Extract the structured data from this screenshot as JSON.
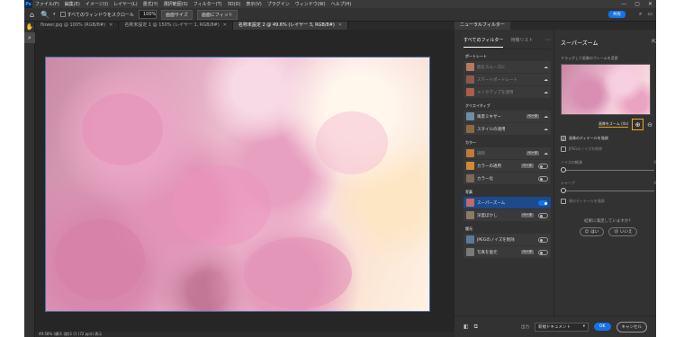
{
  "menubar": {
    "logo": "Ps",
    "items": [
      "ファイル(F)",
      "編集(E)",
      "イメージ(I)",
      "レイヤー(L)",
      "書式(Y)",
      "選択範囲(S)",
      "フィルター(T)",
      "3D(D)",
      "表示(V)",
      "プラグイン",
      "ウィンドウ(W)",
      "ヘルプ(H)"
    ],
    "win_min": "—",
    "win_max": "▢",
    "win_close": "✕"
  },
  "options": {
    "scroll_all_label": "すべてのウィンドウをスクロール",
    "zoom_value": "100%",
    "fit_screen": "画面サイズ",
    "fill_screen": "画面にフィット",
    "share": "共有"
  },
  "doc_tabs": [
    {
      "label": "flower.jpg @ 100% (RGB/8#)",
      "active": false
    },
    {
      "label": "名称未設定 1 @ 150% (レイヤー 1, RGB/8#)",
      "active": false
    },
    {
      "label": "名称未設定 2 @ 49.6% (レイヤー 3, RGB/8#)",
      "active": true
    }
  ],
  "status_bar": "49.58%  (横)1 (縦)1 (1 (72 ppi)) 表示",
  "neural_filters": {
    "tab_label": "ニューラルフィルター",
    "left_tabs": [
      "すべてのフィルター",
      "待機リスト"
    ],
    "categories": [
      {
        "name": "ポートレート",
        "filters": [
          {
            "name": "肌をスムーズに",
            "color": "#b57a5e",
            "state": "cloud"
          },
          {
            "name": "スマートポートレート",
            "color": "#8a5a4c",
            "state": "cloud"
          },
          {
            "name": "メイクアップを適用",
            "color": "#a8604a",
            "state": "cloud"
          }
        ]
      },
      {
        "name": "クリエイティブ",
        "filters": [
          {
            "name": "風景ミキサー",
            "color": "#6c8fa8",
            "state": "beta",
            "badge": "ベータ"
          },
          {
            "name": "スタイルの適用",
            "color": "#8a6a44",
            "state": "cloud"
          }
        ]
      },
      {
        "name": "カラー",
        "filters": [
          {
            "name": "調和",
            "color": "#c07a3a",
            "state": "cloud",
            "badge": "ベータ"
          },
          {
            "name": "カラーの適用",
            "color": "#d08a36",
            "state": "toggle-off",
            "badge": "ベータ"
          },
          {
            "name": "カラー化",
            "color": "#7a6a5a",
            "state": "toggle-off"
          }
        ]
      },
      {
        "name": "写真",
        "filters": [
          {
            "name": "スーパーズーム",
            "color": "#c06a6a",
            "state": "toggle-on",
            "selected": true
          },
          {
            "name": "深度ぼかし",
            "color": "#8a7a66",
            "state": "toggle-off",
            "badge": "ベータ"
          }
        ]
      },
      {
        "name": "復元",
        "filters": [
          {
            "name": "JPEGのノイズを削除",
            "color": "#5a7a9a",
            "state": "toggle-off"
          },
          {
            "name": "写真を復元",
            "color": "#7a7a7a",
            "state": "toggle-off",
            "badge": "ベータ"
          }
        ]
      }
    ],
    "right": {
      "title": "スーパーズーム",
      "subtitle": "ドラッグして画像のフレームを変更",
      "zoom_label": "画像をズーム (4x)",
      "options": [
        {
          "label": "画像のディテールを強調",
          "checked": true,
          "dim": false
        },
        {
          "label": "JPEGのノイズを削除",
          "checked": false,
          "dim": true
        }
      ],
      "sliders": [
        {
          "label": "ノイズの軽減",
          "value": "0"
        },
        {
          "label": "シャープ",
          "value": "0"
        }
      ],
      "face_detail": {
        "label": "顔のディテールを強調",
        "checked": false
      },
      "question": "結果に満足していますか？",
      "yes": "はい",
      "no": "いいえ"
    },
    "bottom": {
      "output_label": "出力",
      "output_value": "新規ドキュメント",
      "ok": "OK",
      "cancel": "キャンセル"
    }
  }
}
